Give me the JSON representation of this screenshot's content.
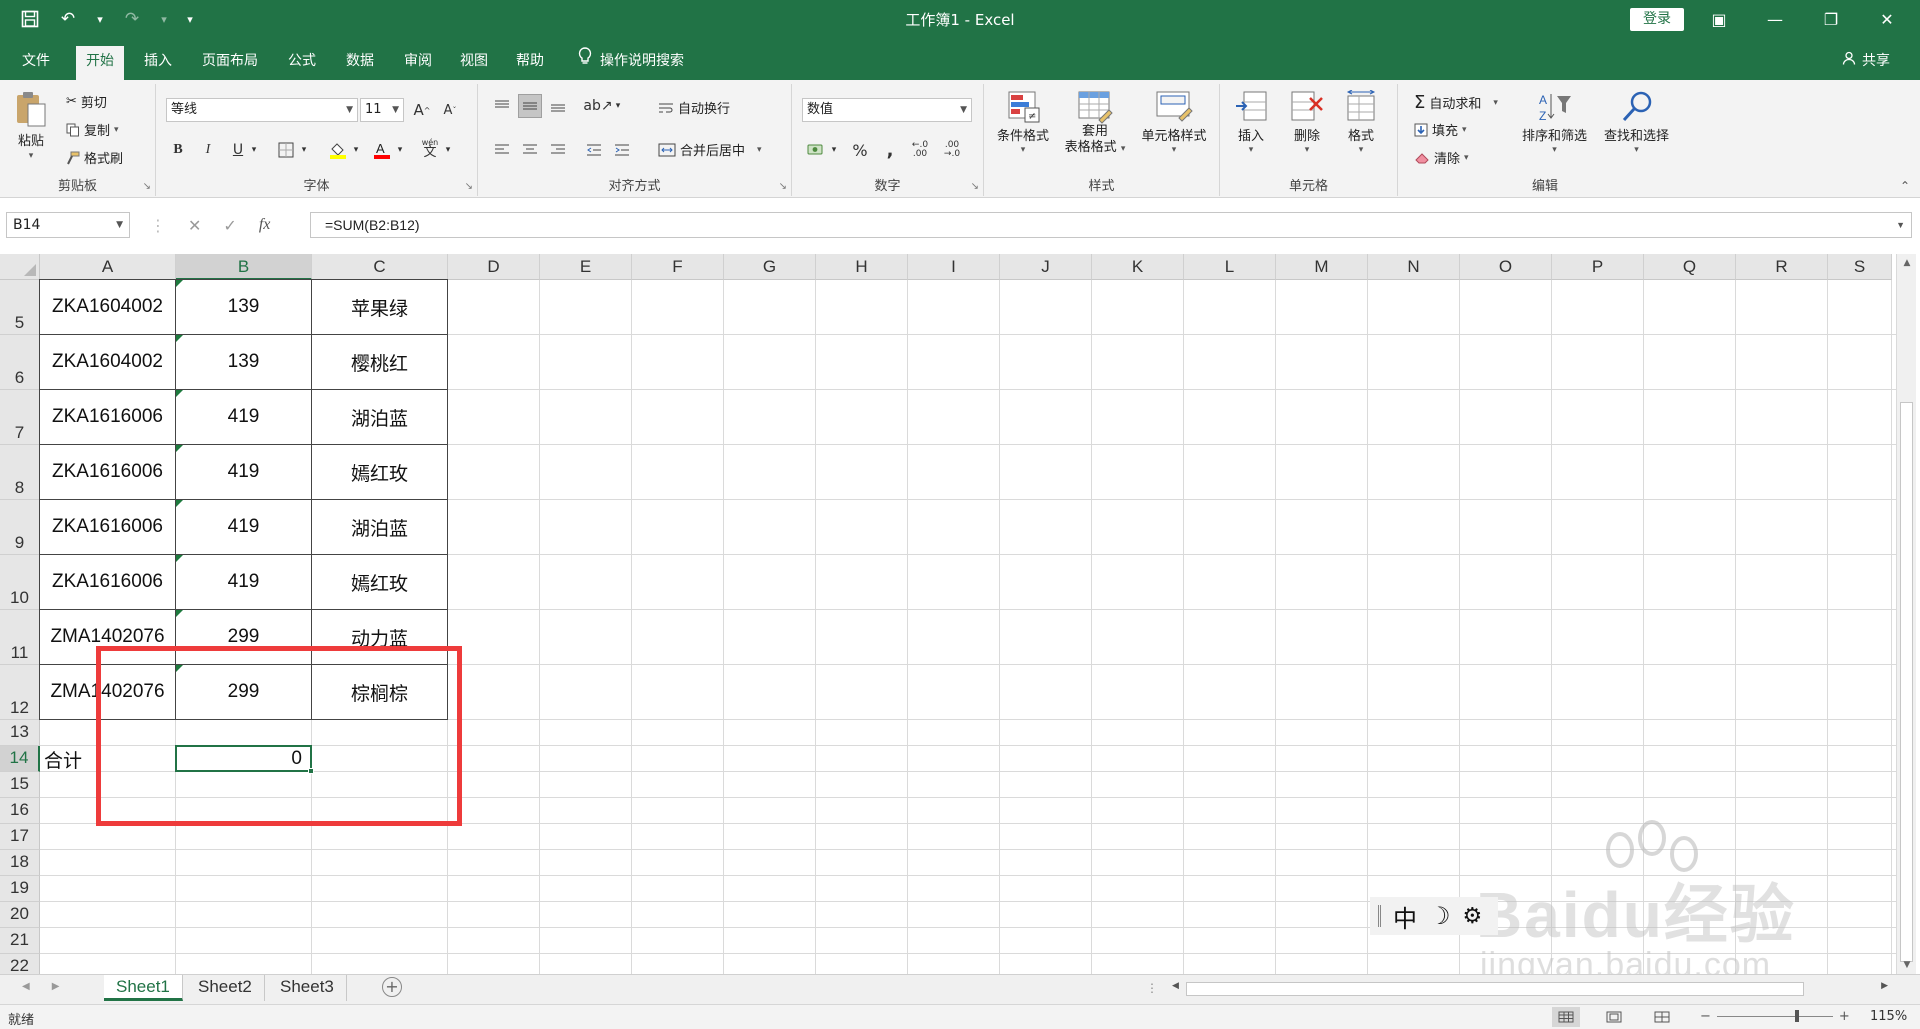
{
  "window": {
    "title": "工作簿1  -  Excel",
    "login_label": "登录",
    "controls": {
      "ribbon_display": "▣",
      "minimize": "—",
      "restore": "❐",
      "close": "✕"
    }
  },
  "qat": {
    "save": "💾",
    "undo": "↶",
    "undo_dropdown": "▾",
    "redo": "↷",
    "redo_dropdown": "▾",
    "customize": "▾"
  },
  "tabs": [
    {
      "label": "文件"
    },
    {
      "label": "开始"
    },
    {
      "label": "插入"
    },
    {
      "label": "页面布局"
    },
    {
      "label": "公式"
    },
    {
      "label": "数据"
    },
    {
      "label": "审阅"
    },
    {
      "label": "视图"
    },
    {
      "label": "帮助"
    }
  ],
  "active_tab": "开始",
  "tell_me": "操作说明搜索",
  "share": "共享",
  "ribbon": {
    "clipboard": {
      "label": "剪贴板",
      "paste": "粘贴",
      "cut": "剪切",
      "copy": "复制",
      "format_painter": "格式刷"
    },
    "font": {
      "label": "字体",
      "font_name": "等线",
      "font_size": "11",
      "bold": "B",
      "italic": "I",
      "underline": "U",
      "increase": "A",
      "decrease": "A",
      "phonetic": "文",
      "phonetic_top": "wén"
    },
    "alignment": {
      "label": "对齐方式",
      "wrap_text": "自动换行",
      "merge_center": "合并后居中"
    },
    "number": {
      "label": "数字",
      "format": "数值",
      "percent": "%",
      "comma": ",",
      "inc_decimal": "←.0\n.00",
      "dec_decimal": ".00\n→.0"
    },
    "styles": {
      "label": "样式",
      "conditional": "条件格式",
      "table_1": "套用",
      "table_2": "表格格式",
      "cell_styles": "单元格样式"
    },
    "cells": {
      "label": "单元格",
      "insert": "插入",
      "delete": "删除",
      "format": "格式"
    },
    "editing": {
      "label": "编辑",
      "autosum": "自动求和",
      "fill": "填充",
      "clear": "清除",
      "sort_filter": "排序和筛选",
      "find_select": "查找和选择"
    }
  },
  "formula_bar": {
    "name_box": "B14",
    "cancel": "✕",
    "enter": "✓",
    "fx": "fx",
    "formula": "=SUM(B2:B12)"
  },
  "columns": [
    "A",
    "B",
    "C",
    "D",
    "E",
    "F",
    "G",
    "H",
    "I",
    "J",
    "K",
    "L",
    "M",
    "N",
    "O",
    "P",
    "Q",
    "R",
    "S"
  ],
  "selected_column": "B",
  "selected_row": "14",
  "rows": [
    {
      "num": "5",
      "a": "ZKA1604002",
      "b": "139",
      "c": "苹果绿"
    },
    {
      "num": "6",
      "a": "ZKA1604002",
      "b": "139",
      "c": "樱桃红"
    },
    {
      "num": "7",
      "a": "ZKA1616006",
      "b": "419",
      "c": "湖泊蓝"
    },
    {
      "num": "8",
      "a": "ZKA1616006",
      "b": "419",
      "c": "嫣红玫"
    },
    {
      "num": "9",
      "a": "ZKA1616006",
      "b": "419",
      "c": "湖泊蓝"
    },
    {
      "num": "10",
      "a": "ZKA1616006",
      "b": "419",
      "c": "嫣红玫"
    },
    {
      "num": "11",
      "a": "ZMA1402076",
      "b": "299",
      "c": "动力蓝"
    },
    {
      "num": "12",
      "a": "ZMA1402076",
      "b": "299",
      "c": "棕榈棕"
    }
  ],
  "small_rows": [
    "13",
    "14",
    "15",
    "16",
    "17",
    "18",
    "19",
    "20",
    "21",
    "22"
  ],
  "total_row": {
    "label": "合计",
    "value": "0"
  },
  "ime": {
    "mode": "中",
    "moon": "☽",
    "gear": "⚙"
  },
  "watermark": {
    "brand": "Baidu经验",
    "sub": "jingyan.baidu.com"
  },
  "sheets": [
    "Sheet1",
    "Sheet2",
    "Sheet3"
  ],
  "active_sheet": "Sheet1",
  "add_sheet": "+",
  "status": {
    "ready": "就绪",
    "zoom": "115%",
    "zoom_minus": "−",
    "zoom_plus": "+"
  },
  "colors": {
    "excel_green": "#217346",
    "highlight_red": "#ee3b3b"
  }
}
